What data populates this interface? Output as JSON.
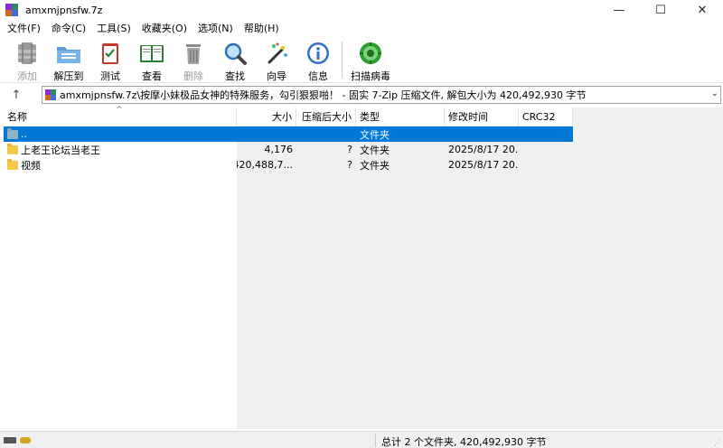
{
  "window": {
    "title": "amxmjpnsfw.7z"
  },
  "controls": {
    "minimize": "—",
    "maximize": "☐",
    "close": "✕"
  },
  "menu": [
    "文件(F)",
    "命令(C)",
    "工具(S)",
    "收藏夹(O)",
    "选项(N)",
    "帮助(H)"
  ],
  "toolbar": [
    {
      "label": "添加",
      "icon": "add-archive-icon",
      "enabled": false
    },
    {
      "label": "解压到",
      "icon": "extract-folder-icon",
      "enabled": true
    },
    {
      "label": "测试",
      "icon": "test-checklist-icon",
      "enabled": true
    },
    {
      "label": "查看",
      "icon": "view-book-icon",
      "enabled": true
    },
    {
      "label": "删除",
      "icon": "delete-trash-icon",
      "enabled": false
    },
    {
      "label": "查找",
      "icon": "find-magnifier-icon",
      "enabled": true
    },
    {
      "label": "向导",
      "icon": "wizard-wand-icon",
      "enabled": true
    },
    {
      "label": "信息",
      "icon": "info-icon",
      "enabled": true
    },
    {
      "label": "扫描病毒",
      "icon": "virus-scan-icon",
      "enabled": true
    }
  ],
  "address": {
    "text": "amxmjpnsfw.7z\\按摩小妹极品女神的特殊服务，勾引狠狠啪！ - 固实 7-Zip 压缩文件, 解包大小为 420,492,930 字节"
  },
  "columns": {
    "name": "名称",
    "size": "大小",
    "packed": "压缩后大小",
    "type": "类型",
    "modified": "修改时间",
    "crc": "CRC32"
  },
  "rows": [
    {
      "name": "..",
      "size": "",
      "packed": "",
      "type": "文件夹",
      "modified": "",
      "crc": "",
      "selected": true
    },
    {
      "name": "上老王论坛当老王",
      "size": "4,176",
      "packed": "?",
      "type": "文件夹",
      "modified": "2025/8/17 20...",
      "crc": "",
      "selected": false
    },
    {
      "name": "视频",
      "size": "420,488,7...",
      "packed": "?",
      "type": "文件夹",
      "modified": "2025/8/17 20...",
      "crc": "",
      "selected": false
    }
  ],
  "status": {
    "text": "总计 2 个文件夹, 420,492,930 字节"
  },
  "colors": {
    "selection": "#0078d7",
    "folder": "#f5c84a"
  }
}
